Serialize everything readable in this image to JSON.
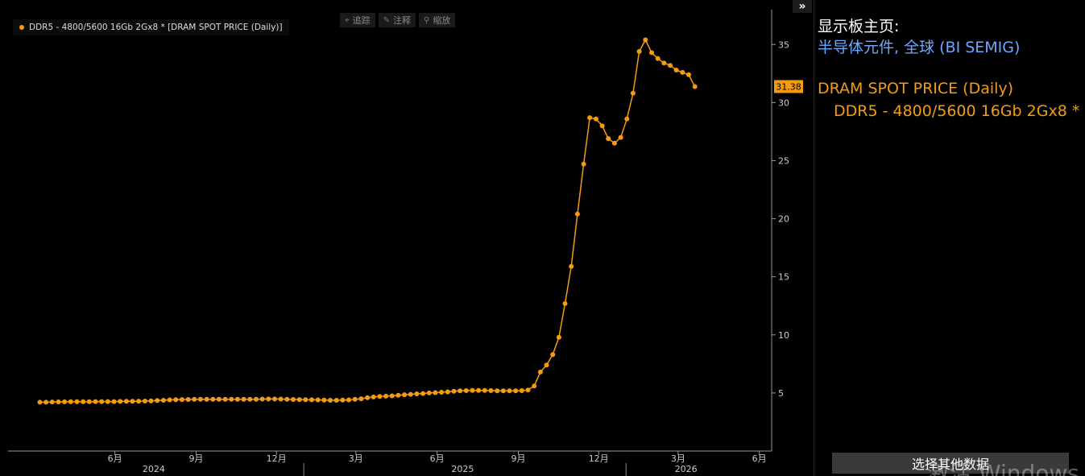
{
  "toolbar": {
    "tracker": "追踪",
    "annotate": "注释",
    "zoom": "缩放",
    "tracker_icon": "crosshair-icon",
    "annotate_icon": "pencil-icon",
    "zoom_icon": "magnifier-icon"
  },
  "legend": {
    "label": "DDR5 - 4800/5600 16Gb 2Gx8 * [DRAM SPOT PRICE (Daily)]"
  },
  "collapse_label": "»",
  "sidebar": {
    "dashboard_label": "显示板主页:",
    "dashboard_link": "半导体元件, 全球 (BI SEMIG)",
    "series_title": "DRAM SPOT PRICE (Daily)",
    "series_subtitle": "DDR5 - 4800/5600 16Gb 2Gx8 *",
    "select_button": "选择其他数据"
  },
  "watermark": "激活 Windows",
  "chart_data": {
    "type": "line",
    "color": "#f39c12",
    "series": [
      {
        "name": "DDR5 - 4800/5600 16Gb 2Gx8 *",
        "x": [
          "2024-03-08",
          "2024-03-15",
          "2024-03-22",
          "2024-03-29",
          "2024-04-05",
          "2024-04-12",
          "2024-04-19",
          "2024-04-26",
          "2024-05-03",
          "2024-05-10",
          "2024-05-17",
          "2024-05-24",
          "2024-05-31",
          "2024-06-07",
          "2024-06-14",
          "2024-06-21",
          "2024-06-28",
          "2024-07-05",
          "2024-07-12",
          "2024-07-19",
          "2024-07-26",
          "2024-08-02",
          "2024-08-09",
          "2024-08-16",
          "2024-08-23",
          "2024-08-30",
          "2024-09-06",
          "2024-09-13",
          "2024-09-20",
          "2024-09-27",
          "2024-10-04",
          "2024-10-11",
          "2024-10-18",
          "2024-10-25",
          "2024-11-01",
          "2024-11-08",
          "2024-11-15",
          "2024-11-22",
          "2024-11-29",
          "2024-12-06",
          "2024-12-13",
          "2024-12-20",
          "2024-12-27",
          "2025-01-03",
          "2025-01-10",
          "2025-01-17",
          "2025-01-24",
          "2025-01-31",
          "2025-02-07",
          "2025-02-14",
          "2025-02-21",
          "2025-02-28",
          "2025-03-07",
          "2025-03-14",
          "2025-03-21",
          "2025-03-28",
          "2025-04-04",
          "2025-04-11",
          "2025-04-18",
          "2025-04-25",
          "2025-05-02",
          "2025-05-09",
          "2025-05-16",
          "2025-05-23",
          "2025-05-30",
          "2025-06-06",
          "2025-06-13",
          "2025-06-20",
          "2025-06-27",
          "2025-07-04",
          "2025-07-11",
          "2025-07-18",
          "2025-07-25",
          "2025-08-01",
          "2025-08-08",
          "2025-08-15",
          "2025-08-22",
          "2025-08-29",
          "2025-09-05",
          "2025-09-12",
          "2025-09-19",
          "2025-09-26",
          "2025-10-03",
          "2025-10-10",
          "2025-10-17",
          "2025-10-24",
          "2025-10-31",
          "2025-11-07",
          "2025-11-14",
          "2025-11-21",
          "2025-11-28",
          "2025-12-05",
          "2025-12-12",
          "2025-12-19",
          "2025-12-26",
          "2026-01-02",
          "2026-01-09",
          "2026-01-16",
          "2026-01-23",
          "2026-01-30",
          "2026-02-06",
          "2026-02-13",
          "2026-02-20",
          "2026-02-27",
          "2026-03-06",
          "2026-03-13",
          "2026-03-20"
        ],
        "values": [
          4.2,
          4.2,
          4.22,
          4.23,
          4.24,
          4.25,
          4.25,
          4.25,
          4.25,
          4.26,
          4.26,
          4.26,
          4.26,
          4.27,
          4.28,
          4.28,
          4.29,
          4.3,
          4.32,
          4.35,
          4.37,
          4.4,
          4.42,
          4.43,
          4.44,
          4.45,
          4.45,
          4.45,
          4.45,
          4.45,
          4.45,
          4.45,
          4.46,
          4.46,
          4.46,
          4.46,
          4.47,
          4.48,
          4.48,
          4.47,
          4.45,
          4.44,
          4.43,
          4.42,
          4.41,
          4.4,
          4.38,
          4.37,
          4.37,
          4.38,
          4.4,
          4.45,
          4.5,
          4.6,
          4.65,
          4.7,
          4.72,
          4.75,
          4.8,
          4.85,
          4.88,
          4.92,
          4.95,
          5.0,
          5.03,
          5.06,
          5.1,
          5.15,
          5.18,
          5.2,
          5.22,
          5.22,
          5.22,
          5.2,
          5.18,
          5.18,
          5.18,
          5.18,
          5.2,
          5.25,
          5.6,
          6.8,
          7.4,
          8.3,
          9.8,
          12.7,
          15.9,
          20.4,
          24.7,
          28.7,
          28.6,
          28.0,
          26.9,
          26.5,
          27.0,
          28.6,
          30.8,
          34.4,
          35.4,
          34.3,
          33.8,
          33.4,
          33.2,
          32.8,
          32.6,
          32.4,
          31.38
        ]
      }
    ],
    "last_value_label": "31.38",
    "xlim": [
      "2024-02-01",
      "2026-06-15"
    ],
    "ylim": [
      0,
      38
    ],
    "yticks": [
      5,
      10,
      15,
      20,
      25,
      30,
      35
    ],
    "xticks": [
      {
        "date": "2024-06-01",
        "label": "6月"
      },
      {
        "date": "2024-09-01",
        "label": "9月"
      },
      {
        "date": "2024-12-01",
        "label": "12月"
      },
      {
        "date": "2025-03-01",
        "label": "3月"
      },
      {
        "date": "2025-06-01",
        "label": "6月"
      },
      {
        "date": "2025-09-01",
        "label": "9月"
      },
      {
        "date": "2025-12-01",
        "label": "12月"
      },
      {
        "date": "2026-03-01",
        "label": "3月"
      },
      {
        "date": "2026-06-01",
        "label": "6月"
      }
    ],
    "years": [
      {
        "label": "2024",
        "center": "2024-07-15",
        "start": "2024-02-01"
      },
      {
        "label": "2025",
        "center": "2025-06-30",
        "start": "2025-01-01"
      },
      {
        "label": "2026",
        "center": "2026-03-10",
        "start": "2026-01-01"
      }
    ],
    "grid": false,
    "legend_position": "top-left"
  }
}
